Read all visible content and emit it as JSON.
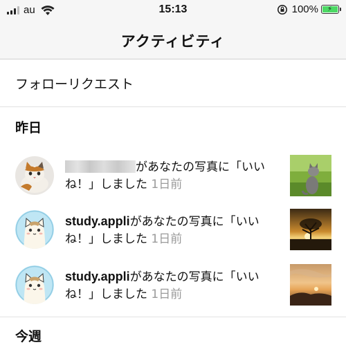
{
  "status_bar": {
    "carrier": "au",
    "time": "15:13",
    "battery_percent": "100%",
    "battery_level": 1.0
  },
  "nav": {
    "title": "アクティビティ"
  },
  "follow_requests": {
    "label": "フォローリクエスト"
  },
  "sections": {
    "yesterday": "昨日",
    "this_week": "今週"
  },
  "activities": [
    {
      "username": "",
      "message_line1": "があなたの写真に「いい",
      "message_line2": "ね！」しました",
      "time_ago": "1日前",
      "avatar_icon": "kitten-photo-avatar",
      "thumb_icon": "cat-on-grass-thumbnail"
    },
    {
      "username": "study.appli",
      "message_line1": "があなたの写真に「いい",
      "message_line2": "ね！」しました",
      "time_ago": "1日前",
      "avatar_icon": "cartoon-cat-avatar",
      "thumb_icon": "sunset-tree-thumbnail"
    },
    {
      "username": "study.appli",
      "message_line1": "があなたの写真に「いい",
      "message_line2": "ね！」しました",
      "time_ago": "1日前",
      "avatar_icon": "cartoon-cat-avatar",
      "thumb_icon": "sunset-sky-thumbnail"
    }
  ],
  "colors": {
    "accent_battery": "#4cd964",
    "time_gray": "#9a9a9a",
    "bar_background": "#f6f6f6"
  }
}
